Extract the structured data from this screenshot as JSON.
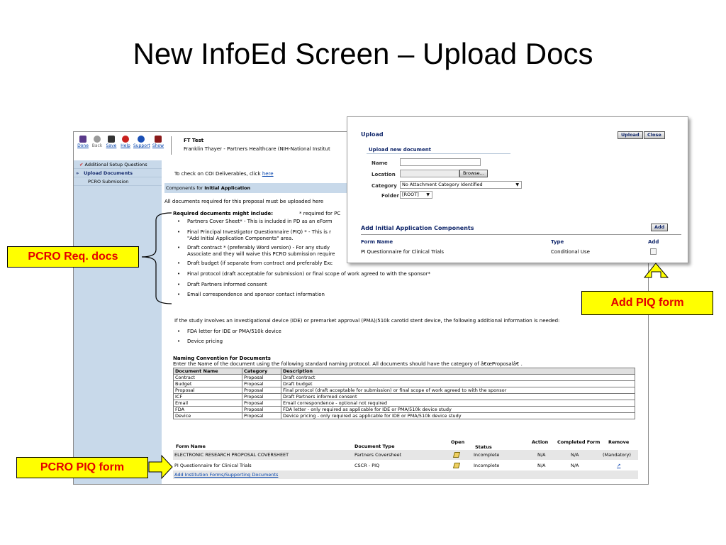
{
  "slide": {
    "title": "New InfoEd Screen – Upload Docs"
  },
  "toolbar": {
    "buttons": [
      {
        "label": "Done",
        "icon": "exit-icon",
        "color": "#5a3a8a"
      },
      {
        "label": "Back",
        "icon": "back-arrow-icon",
        "color": "#9a9a9a"
      },
      {
        "label": "Save",
        "icon": "floppy-disk-icon",
        "color": "#333333"
      },
      {
        "label": "Help",
        "icon": "help-icon",
        "color": "#c9211e"
      },
      {
        "label": "Support",
        "icon": "info-icon",
        "color": "#1a4fb5"
      },
      {
        "label": "Show",
        "icon": "show-icon",
        "color": "#8a1a1a"
      }
    ]
  },
  "project": {
    "title": "FT Test",
    "subtitle": "Franklin Thayer - Partners Healthcare (NIH-National Institut"
  },
  "sidebar": {
    "items": [
      {
        "label": "Additional Setup Questions"
      },
      {
        "label": "Upload Documents",
        "prefix": "»"
      },
      {
        "label": "PCRO Submission"
      }
    ]
  },
  "main": {
    "coi_text": "To check on COI Deliverables, click ",
    "coi_link": "here",
    "components_prefix": "Components for ",
    "components_bold": "Initial Application",
    "all_docs_text": "All documents required for this proposal must be uploaded here",
    "required_heading": "Required documents might include:",
    "required_note": "* required for PC",
    "required_items": [
      "Partners Cover Sheet* - This is included in PD as an eForm",
      "Final Principal Investigator Questionnaire (PIQ) * - This is r",
      "\"Add Initial Application Components\" area.",
      "Draft contract * (preferably Word version) - For any study",
      "Associate and they will waive this PCRO submission require",
      "Draft budget (if separate from contract and preferably Exc",
      "Final protocol (draft acceptable for submission) or final scope of work agreed to with the sponsor*",
      "Draft Partners informed consent",
      "Email correspondence and sponsor contact information"
    ],
    "ide_text": "If the study involves an investigational device (IDE) or premarket approval (PMA)/510k carotid stent device, the following additional information is needed:",
    "ide_items": [
      "FDA letter for IDE or PMA/510k device",
      "Device pricing"
    ],
    "naming_heading": "Naming Convention for Documents",
    "naming_text": "Enter the Name of the document using the following standard naming protocol. All documents should have the category of â€œProposalâ€  .",
    "naming_columns": [
      "Document Name",
      "Category",
      "Description"
    ],
    "naming_rows": [
      [
        "Contract",
        "Proposal",
        "Draft contract"
      ],
      [
        "Budget",
        "Proposal",
        "Draft budget"
      ],
      [
        "Proposal",
        "Proposal",
        "Final protocol (draft acceptable for submission) or final scope of work agreed to with the sponsor"
      ],
      [
        "ICF",
        "Proposal",
        "Draft Partners informed consent"
      ],
      [
        "Email",
        "Proposal",
        "Email correspondence - optional not required"
      ],
      [
        "FDA",
        "Proposal",
        "FDA letter - only required as applicable for IDE or PMA/510k device study"
      ],
      [
        "Device",
        "Proposal",
        "Device pricing - only required as applicable for IDE or PMA/510k device study"
      ]
    ],
    "forms_columns": [
      "Form Name",
      "Document Type",
      "Open",
      "Status",
      "Action",
      "Completed Form",
      "Remove"
    ],
    "forms_rows": [
      {
        "name": "ELECTRONIC RESEARCH PROPOSAL COVERSHEET",
        "type": "Partners Coversheet",
        "status": "Incomplete",
        "action": "N/A",
        "completed": "N/A",
        "remove": "(Mandatory)"
      },
      {
        "name": "PI Questionnaire for Clinical Trials",
        "type": "CSCR - PIQ",
        "status": "Incomplete",
        "action": "N/A",
        "completed": "N/A",
        "remove": ""
      }
    ],
    "add_forms_link": "Add Institution Forms/Supporting Documents"
  },
  "popup": {
    "title": "Upload",
    "upload_button": "Upload",
    "close_button": "Close",
    "subtitle": "Upload new document",
    "name_label": "Name",
    "name_value": "",
    "location_label": "Location",
    "browse_button": "Browse...",
    "category_label": "Category",
    "category_value": "No Attachment Category Identified",
    "folder_label": "Folder",
    "folder_value": "[ROOT]",
    "add_heading": "Add Initial Application  Components",
    "add_button": "Add",
    "columns": {
      "form_name": "Form Name",
      "type": "Type",
      "add": "Add"
    },
    "row": {
      "form_name": "PI Questionnaire for Clinical Trials",
      "type": "Conditional Use",
      "checked": false
    }
  },
  "annotations": {
    "req_docs": "PCRO Req. docs",
    "add_piq": "Add PIQ form",
    "piq_form": "PCRO PIQ form",
    "callout_bg": "#ffff00",
    "callout_text_color": "#e40000"
  }
}
